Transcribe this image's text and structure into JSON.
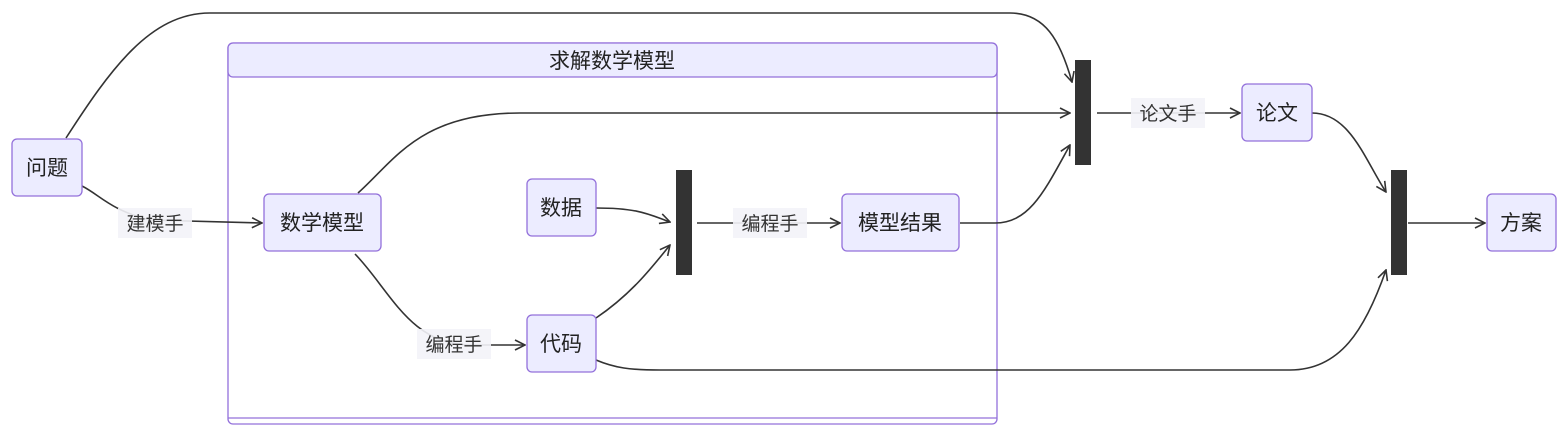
{
  "diagram": {
    "type": "flowchart",
    "direction": "left-to-right",
    "subgraph": {
      "id": "solve",
      "title": "求解数学模型"
    },
    "nodes": [
      {
        "id": "problem",
        "label": "问题"
      },
      {
        "id": "math_model",
        "label": "数学模型"
      },
      {
        "id": "data",
        "label": "数据"
      },
      {
        "id": "code",
        "label": "代码"
      },
      {
        "id": "model_result",
        "label": "模型结果"
      },
      {
        "id": "paper",
        "label": "论文"
      },
      {
        "id": "plan",
        "label": "方案"
      }
    ],
    "edges": [
      {
        "id": "e1",
        "from": "problem",
        "to": "math_model",
        "label": "建模手"
      },
      {
        "id": "e2",
        "from": "math_model",
        "to": "code",
        "label": "编程手"
      },
      {
        "id": "e3",
        "from": "join1",
        "to": "model_result",
        "label": "编程手"
      },
      {
        "id": "e4",
        "from": "join2",
        "to": "paper",
        "label": "论文手"
      },
      {
        "id": "e5",
        "from": "join3",
        "to": "plan",
        "label": ""
      }
    ],
    "colors": {
      "node_fill": "#ECECFF",
      "node_stroke": "#9370DB",
      "edge": "#333333",
      "fork_bar": "#333333"
    }
  }
}
